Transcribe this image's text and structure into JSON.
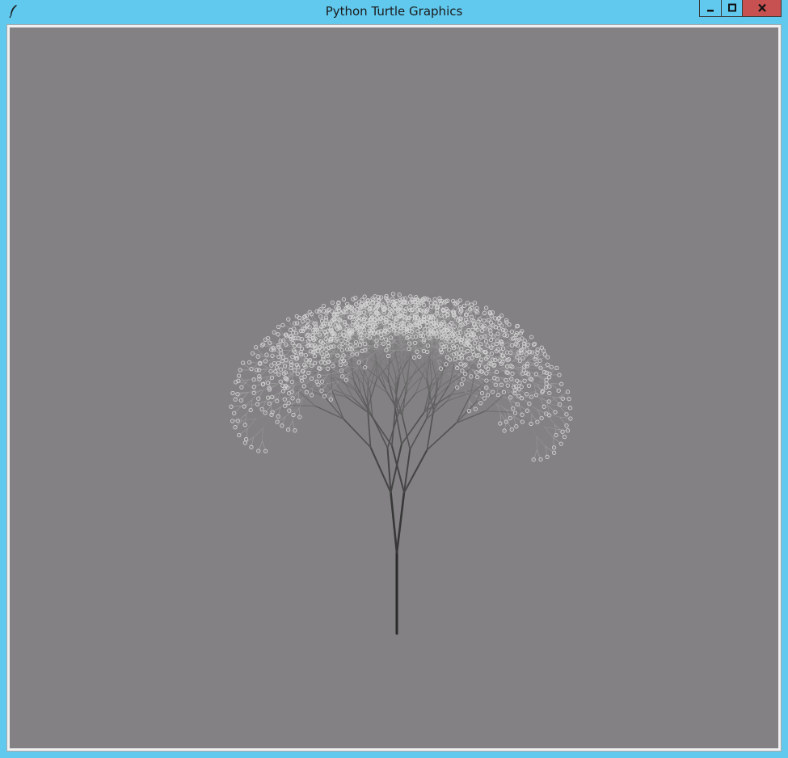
{
  "window": {
    "title": "Python Turtle Graphics",
    "titlebar_color": "#62c9ee",
    "close_button_color": "#c75050"
  },
  "controls": {
    "minimize": "minimize-icon",
    "maximize": "maximize-icon",
    "close": "close-icon"
  },
  "canvas": {
    "background": "#848184",
    "drawing": "fractal-tree",
    "trunk_color": "#2a2a2a",
    "leaf_color": "#d2d2d2"
  }
}
